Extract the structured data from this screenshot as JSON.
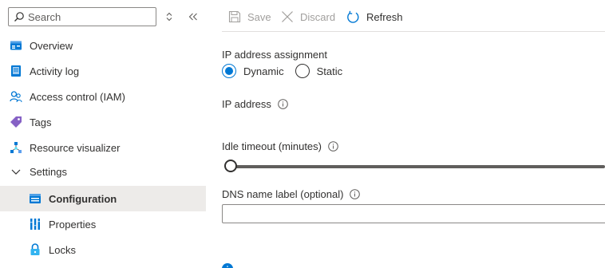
{
  "sidebar": {
    "search_placeholder": "Search",
    "items": [
      {
        "label": "Overview",
        "icon": "overview-icon"
      },
      {
        "label": "Activity log",
        "icon": "activity-log-icon"
      },
      {
        "label": "Access control (IAM)",
        "icon": "iam-icon"
      },
      {
        "label": "Tags",
        "icon": "tag-icon"
      },
      {
        "label": "Resource visualizer",
        "icon": "resource-visualizer-icon"
      },
      {
        "label": "Settings",
        "icon": "chevron-down-icon"
      },
      {
        "label": "Configuration",
        "icon": "configuration-icon",
        "selected": true
      },
      {
        "label": "Properties",
        "icon": "properties-icon"
      },
      {
        "label": "Locks",
        "icon": "lock-icon"
      }
    ]
  },
  "toolbar": {
    "save_label": "Save",
    "discard_label": "Discard",
    "refresh_label": "Refresh"
  },
  "form": {
    "ip_assignment_label": "IP address assignment",
    "dynamic_label": "Dynamic",
    "static_label": "Static",
    "selected_assignment": "Dynamic",
    "ip_address_label": "IP address",
    "idle_timeout_label": "Idle timeout (minutes)",
    "idle_timeout_value": 4,
    "dns_label": "DNS name label (optional)",
    "dns_value": ""
  },
  "colors": {
    "accent": "#0078d4",
    "selected_bg": "#edebe9",
    "disabled_text": "#a19f9d"
  }
}
